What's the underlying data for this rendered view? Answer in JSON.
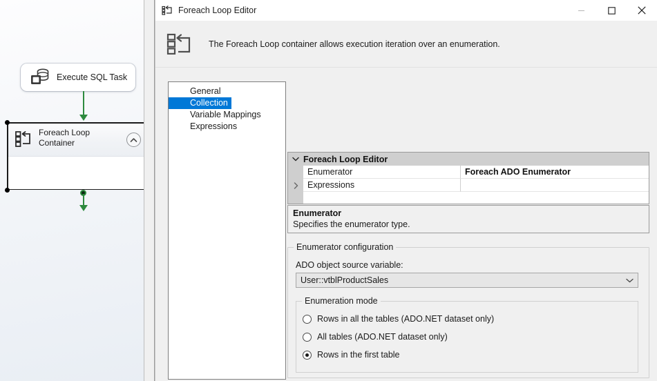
{
  "window": {
    "title": "Foreach Loop Editor",
    "title_icon": "foreach-loop-icon",
    "minimize_label": "—",
    "maximize_label": "□",
    "close_label": "✕"
  },
  "header": {
    "icon": "foreach-loop-large-icon",
    "description": "The Foreach Loop container allows execution iteration over an enumeration."
  },
  "nav": {
    "items": [
      {
        "label": "General",
        "selected": false
      },
      {
        "label": "Collection",
        "selected": true
      },
      {
        "label": "Variable Mappings",
        "selected": false
      },
      {
        "label": "Expressions",
        "selected": false
      }
    ]
  },
  "property_grid": {
    "group_title": "Foreach Loop Editor",
    "rows": [
      {
        "name": "Enumerator",
        "value": "Foreach ADO Enumerator",
        "expandable": false,
        "bold_value": true
      },
      {
        "name": "Expressions",
        "value": "",
        "expandable": true,
        "bold_value": false
      }
    ]
  },
  "description_panel": {
    "title": "Enumerator",
    "text": "Specifies the enumerator type."
  },
  "enumerator_configuration": {
    "legend": "Enumerator configuration",
    "ado_variable_label": "ADO object source variable:",
    "ado_variable_value": "User::vtblProductSales",
    "enumeration_mode": {
      "legend": "Enumeration mode",
      "options": [
        {
          "label": "Rows in all the tables (ADO.NET dataset only)",
          "checked": false
        },
        {
          "label": "All tables (ADO.NET dataset only)",
          "checked": false
        },
        {
          "label": "Rows in the first table",
          "checked": true
        }
      ]
    }
  },
  "canvas": {
    "nodes": [
      {
        "label": "Execute SQL Task",
        "icon": "execute-sql-task-icon"
      },
      {
        "label": "Foreach Loop\nContainer",
        "label_line1": "Foreach Loop",
        "label_line2": "Container",
        "icon": "foreach-loop-container-icon"
      }
    ]
  },
  "colors": {
    "accent_selection": "#0078d7",
    "arrow_green": "#2d8a3e",
    "dialog_background": "#f0f0f0",
    "grid_header": "#cfcfcf"
  }
}
